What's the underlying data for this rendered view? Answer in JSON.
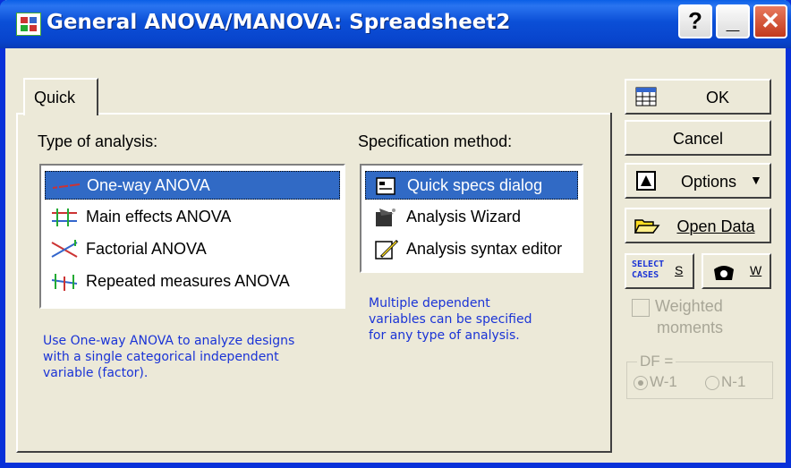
{
  "window": {
    "title": "General ANOVA/MANOVA: Spreadsheet2",
    "help_label": "?",
    "minimize_label": "_",
    "close_label": "✕"
  },
  "tabs": [
    {
      "label": "Quick"
    }
  ],
  "type_of_analysis": {
    "label": "Type of analysis:",
    "items": [
      {
        "label": "One-way ANOVA",
        "selected": true,
        "icon": "one-way-icon"
      },
      {
        "label": "Main effects ANOVA",
        "selected": false,
        "icon": "main-effects-icon"
      },
      {
        "label": "Factorial ANOVA",
        "selected": false,
        "icon": "factorial-icon"
      },
      {
        "label": "Repeated measures ANOVA",
        "selected": false,
        "icon": "repeated-measures-icon"
      }
    ],
    "note_lines": [
      "Use One-way ANOVA to analyze designs",
      "with a single categorical independent",
      "variable (factor)."
    ]
  },
  "specification_method": {
    "label": "Specification method:",
    "items": [
      {
        "label": "Quick specs dialog",
        "selected": true,
        "icon": "quick-specs-icon"
      },
      {
        "label": "Analysis Wizard",
        "selected": false,
        "icon": "wizard-icon"
      },
      {
        "label": "Analysis syntax editor",
        "selected": false,
        "icon": "syntax-editor-icon"
      }
    ],
    "note_lines": [
      "Multiple dependent",
      "variables can be specified",
      "for any type of analysis."
    ]
  },
  "buttons": {
    "ok": "OK",
    "cancel": "Cancel",
    "options": "Options",
    "open_data": "Open Data",
    "select_cases_line1": "SELECT",
    "select_cases_line2": "CASES",
    "select_cases_key": "S",
    "weight_key": "W"
  },
  "weighted_moments": {
    "line1": "Weighted",
    "line2": "moments",
    "checked": false
  },
  "df_group": {
    "label": "DF =",
    "options": [
      "W-1",
      "N-1"
    ],
    "selected": "W-1"
  },
  "colors": {
    "titlebar": "#0a5fe6",
    "selection": "#316ac5",
    "note_text": "#1a33d6",
    "window_bg": "#ece9d8"
  }
}
